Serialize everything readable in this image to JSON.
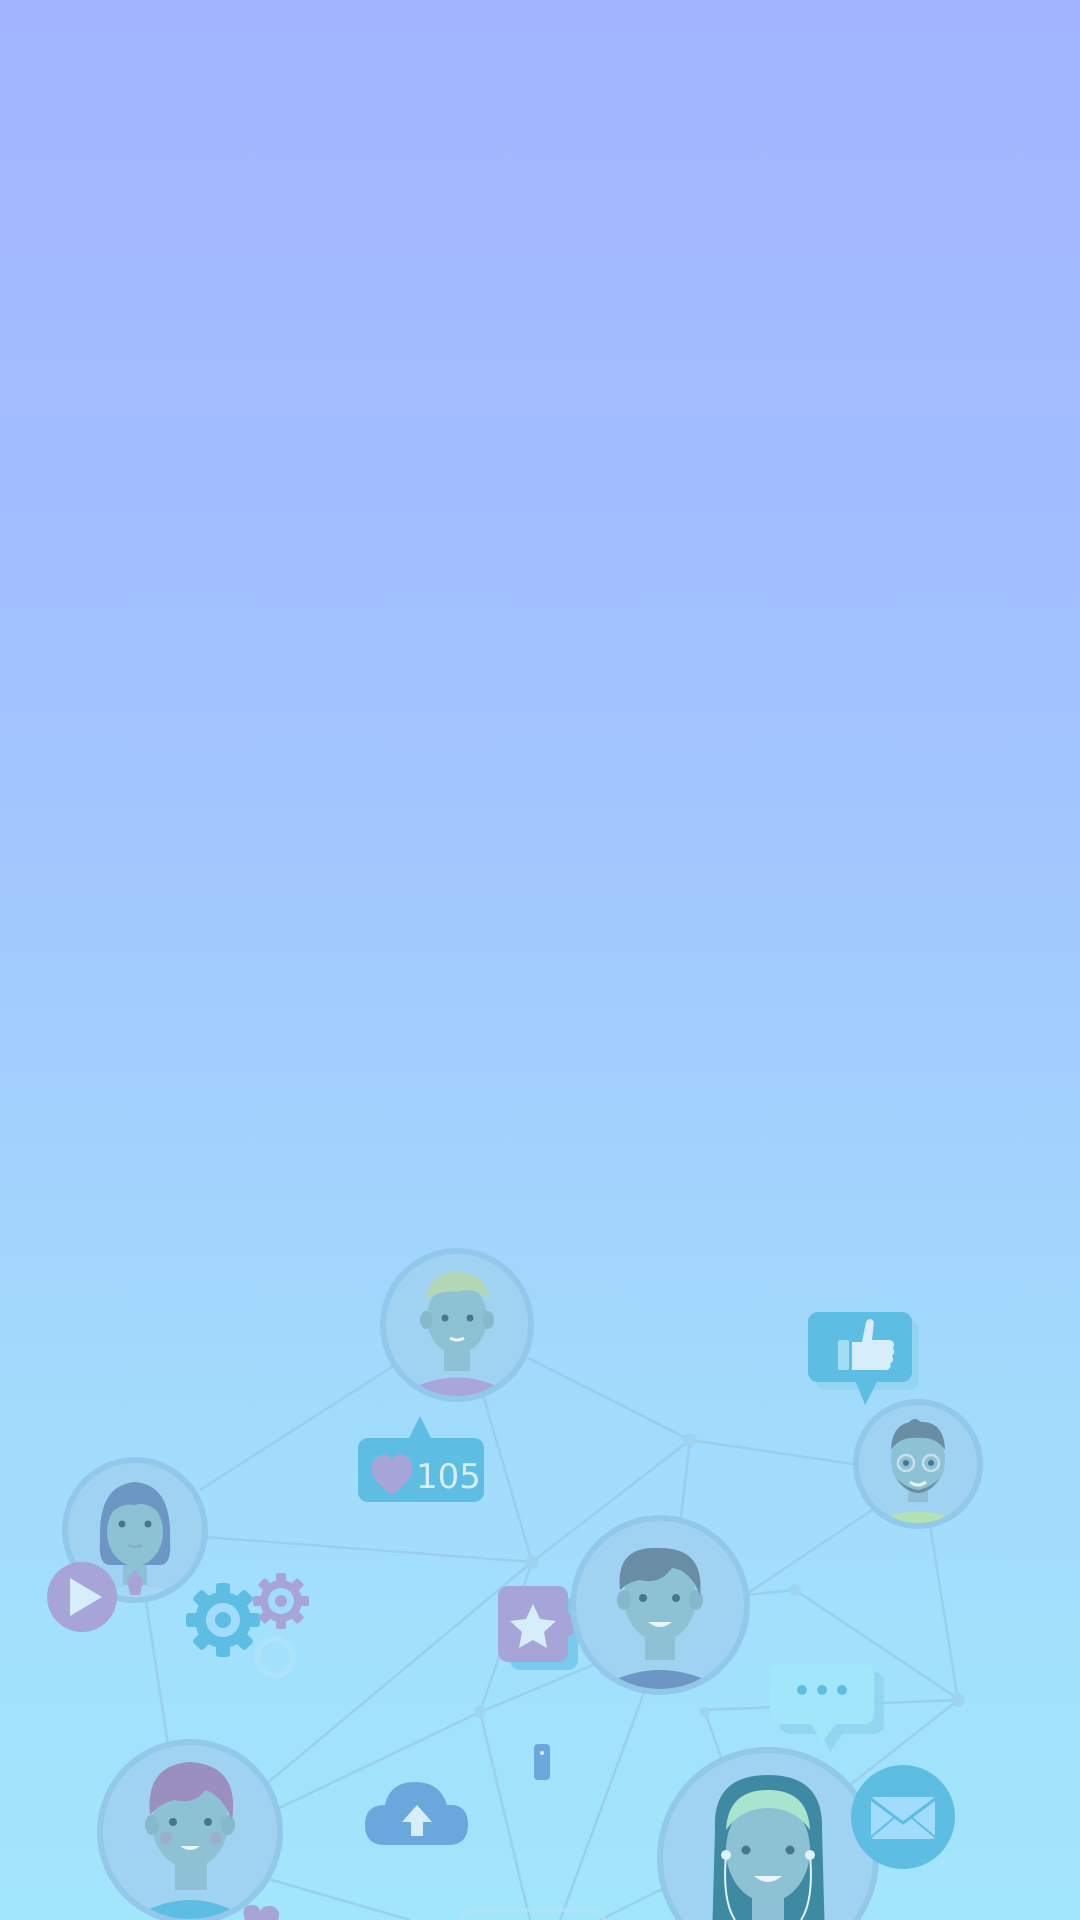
{
  "screen": {
    "gradient_top": "#a2b4ff",
    "gradient_bottom": "#a2e6fc"
  },
  "like_badge": {
    "count": "105",
    "icon": "heart-icon",
    "color": "#5ebde3"
  },
  "icons": {
    "thumbs_up": "thumbs-up-icon",
    "play": "play-icon",
    "gear": "gear-icon",
    "star": "star-icon",
    "chat": "chat-icon",
    "cloud_upload": "cloud-upload-icon",
    "mail": "mail-icon"
  },
  "colors": {
    "accent_blue": "#5ebde3",
    "accent_purple": "#a7a5d8",
    "network_line": "#94c9e8"
  }
}
